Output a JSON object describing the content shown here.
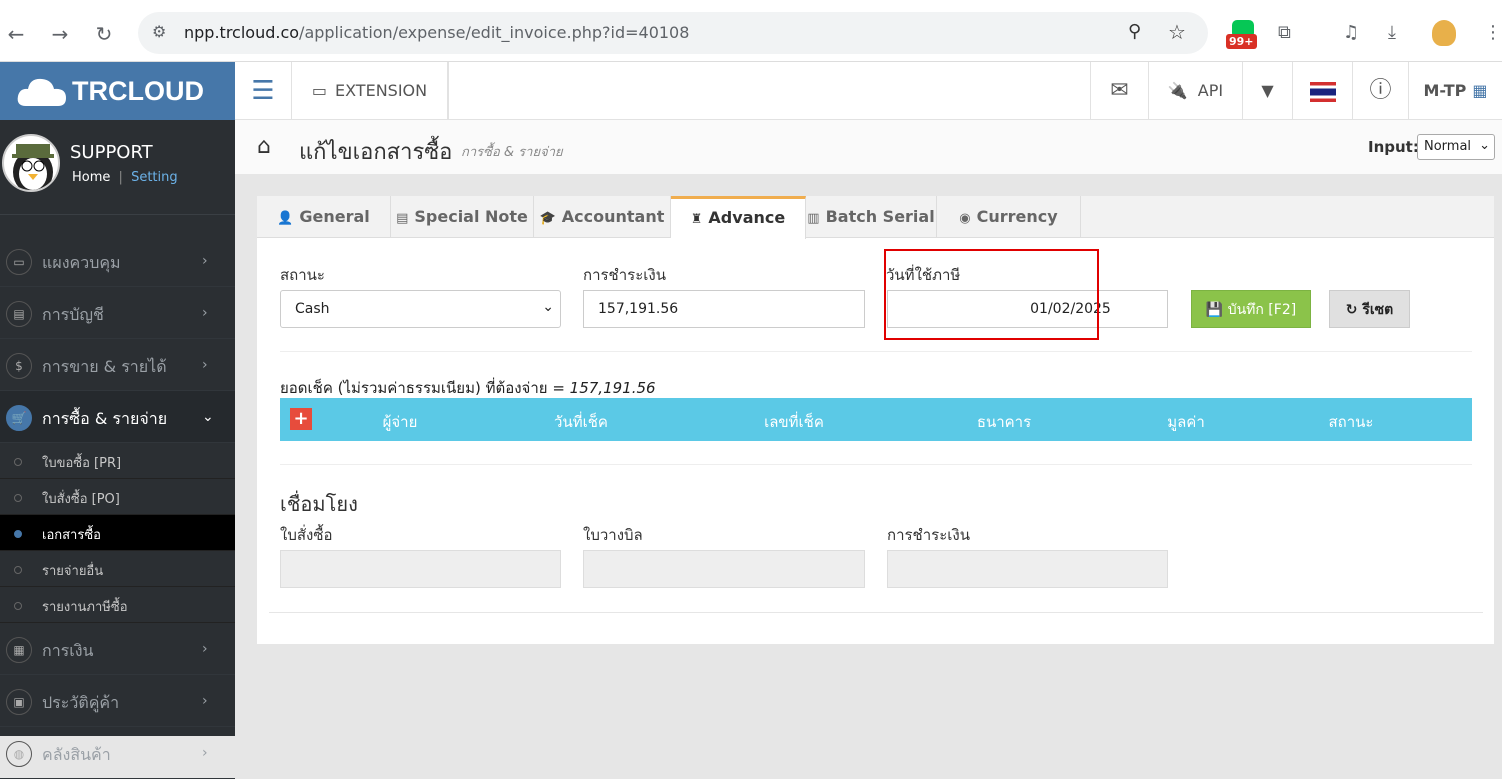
{
  "browser": {
    "url_host": "npp.trcloud.co",
    "url_path": "/application/expense/edit_invoice.php?id=40108",
    "badge": "99+"
  },
  "sidebar": {
    "logo_text": "TRCLOUD",
    "user_name": "SUPPORT",
    "home_link": "Home",
    "setting_link": "Setting",
    "separator": "|",
    "items": [
      {
        "label": "แผงควบคุม",
        "icon": "monitor-icon",
        "glyph": "▭",
        "active": false
      },
      {
        "label": "การบัญชี",
        "icon": "book-icon",
        "glyph": "▤",
        "active": false
      },
      {
        "label": "การขาย & รายได้",
        "icon": "dollar-icon",
        "glyph": "$",
        "active": false
      },
      {
        "label": "การซื้อ & รายจ่าย",
        "icon": "cart-icon",
        "glyph": "🛒",
        "active": true
      },
      {
        "label": "การเงิน",
        "icon": "calendar-icon",
        "glyph": "▦",
        "active": false
      },
      {
        "label": "ประวัติคู่ค้า",
        "icon": "contact-icon",
        "glyph": "▣",
        "active": false
      },
      {
        "label": "คลังสินค้า",
        "icon": "box-icon",
        "glyph": "◍",
        "active": false
      }
    ],
    "subitems": [
      {
        "label": "ใบขอซื้อ [PR]",
        "active": false
      },
      {
        "label": "ใบสั่งซื้อ [PO]",
        "active": false
      },
      {
        "label": "เอกสารซื้อ",
        "active": true
      },
      {
        "label": "รายจ่ายอื่น",
        "active": false
      },
      {
        "label": "รายงานภาษีซื้อ",
        "active": false
      }
    ]
  },
  "topbar": {
    "extension_label": "EXTENSION",
    "api_label": "API",
    "company_label": "M-TP"
  },
  "header": {
    "title": "แก้ไขเอกสารซื้อ",
    "subtitle": "การซื้อ & รายจ่าย",
    "input_label": "Input:",
    "input_value": "Normal"
  },
  "tabs": [
    {
      "label": "General",
      "icon": "user-icon",
      "glyph": "👤"
    },
    {
      "label": "Special Note",
      "icon": "note-icon",
      "glyph": "▤"
    },
    {
      "label": "Accountant",
      "icon": "graduation-cap-icon",
      "glyph": "🎓"
    },
    {
      "label": "Advance",
      "icon": "chess-icon",
      "glyph": "♜"
    },
    {
      "label": "Batch Serial",
      "icon": "barcode-icon",
      "glyph": "▥"
    },
    {
      "label": "Currency",
      "icon": "globe-icon",
      "glyph": "◉"
    }
  ],
  "form": {
    "status_label": "สถานะ",
    "status_value": "Cash",
    "payment_label": "การชำระเงิน",
    "payment_value": "157,191.56",
    "tax_date_label": "วันที่ใช้ภาษี",
    "tax_date_value": "01/02/2025",
    "save_label": "บันทึก [F2]",
    "reset_label": "รีเซต"
  },
  "cheque": {
    "summary_prefix": "ยอดเช็ค (ไม่รวมค่าธรรมเนียม) ที่ต้องจ่าย = ",
    "summary_value": "157,191.56",
    "add_glyph": "+",
    "columns": [
      "ผู้จ่าย",
      "วันที่เช็ค",
      "เลขที่เช็ค",
      "ธนาคาร",
      "มูลค่า",
      "สถานะ"
    ]
  },
  "links": {
    "title": "เชื่อมโยง",
    "po_label": "ใบสั่งซื้อ",
    "billing_label": "ใบวางบิล",
    "payment_label": "การชำระเงิน"
  },
  "colors": {
    "sidebar_bg": "#2b2f33",
    "logo_bg": "#4677a9",
    "table_header": "#5bc9e6",
    "save_button": "#8bc34a",
    "highlight_box": "#e00000"
  }
}
